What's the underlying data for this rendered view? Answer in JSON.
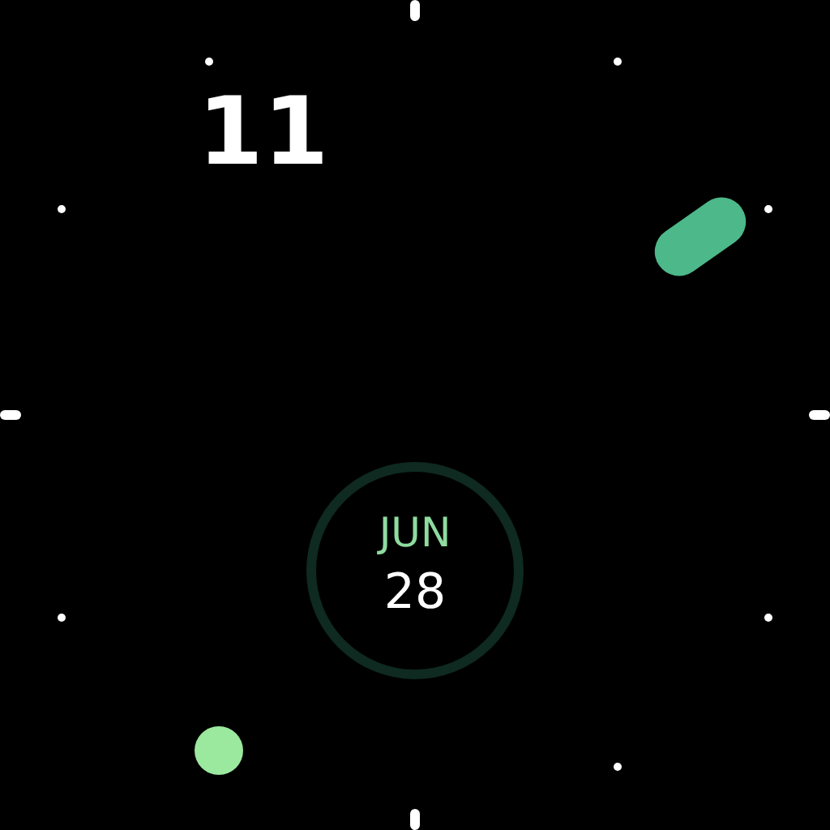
{
  "hour": "11",
  "date": {
    "month": "JUN",
    "day": "28"
  }
}
